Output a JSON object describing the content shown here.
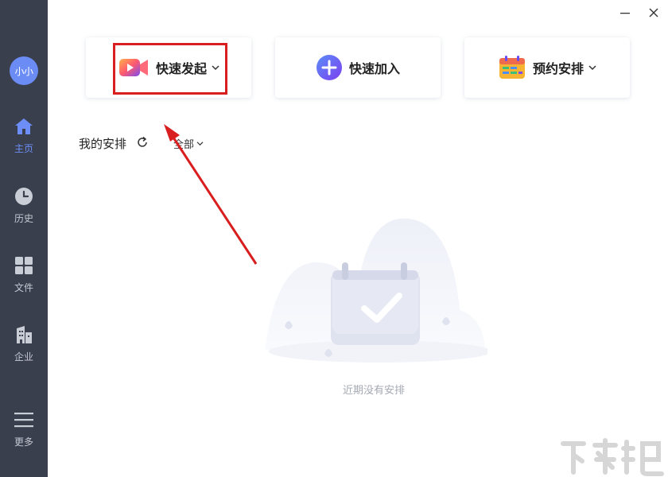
{
  "sidebar": {
    "avatar_text": "小小",
    "items": [
      {
        "label": "主页",
        "icon": "home-icon",
        "active": true
      },
      {
        "label": "历史",
        "icon": "clock-icon",
        "active": false
      },
      {
        "label": "文件",
        "icon": "grid-icon",
        "active": false
      },
      {
        "label": "企业",
        "icon": "building-icon",
        "active": false
      },
      {
        "label": "更多",
        "icon": "menu-icon",
        "active": false
      }
    ]
  },
  "actions": {
    "quick_start": "快速发起",
    "quick_join": "快速加入",
    "schedule": "预约安排"
  },
  "section": {
    "title": "我的安排",
    "filter": "全部"
  },
  "empty_state": {
    "text": "近期没有安排"
  },
  "colors": {
    "sidebar_bg": "#3a3f4d",
    "accent": "#6d8ef6",
    "highlight": "#d81e1e"
  }
}
